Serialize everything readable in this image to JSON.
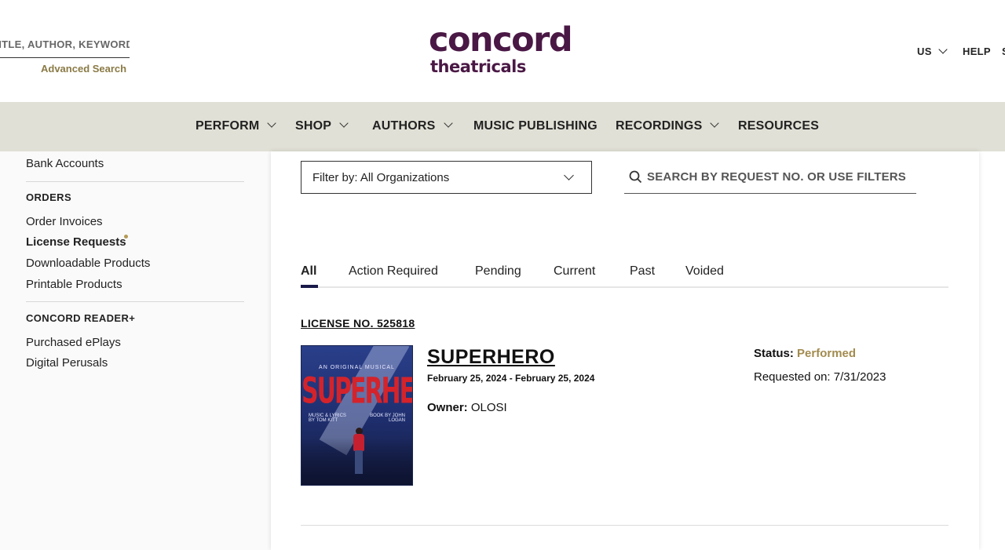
{
  "header": {
    "search_placeholder": "TITLE, AUTHOR, KEYWORD",
    "advanced_search": "Advanced Search",
    "logo_top": "concord",
    "logo_bottom": "theatricals",
    "region": "US",
    "help": "HELP"
  },
  "nav": {
    "items": [
      {
        "label": "PERFORM",
        "dropdown": true
      },
      {
        "label": "SHOP",
        "dropdown": true
      },
      {
        "label": "AUTHORS",
        "dropdown": true
      },
      {
        "label": "MUSIC PUBLISHING",
        "dropdown": false
      },
      {
        "label": "RECORDINGS",
        "dropdown": true
      },
      {
        "label": "RESOURCES",
        "dropdown": false
      }
    ]
  },
  "sidebar": {
    "bank_accounts": "Bank Accounts",
    "orders_heading": "ORDERS",
    "order_invoices": "Order Invoices",
    "license_requests": "License Requests",
    "downloadable_products": "Downloadable Products",
    "printable_products": "Printable Products",
    "reader_heading": "CONCORD READER+",
    "purchased_eplays": "Purchased ePlays",
    "digital_perusals": "Digital Perusals"
  },
  "filters": {
    "filter_label": "Filter by: All Organizations",
    "search_placeholder": "SEARCH BY REQUEST NO. OR USE FILTERS"
  },
  "tabs": [
    {
      "label": "All",
      "active": true
    },
    {
      "label": "Action Required",
      "active": false
    },
    {
      "label": "Pending",
      "active": false
    },
    {
      "label": "Current",
      "active": false
    },
    {
      "label": "Past",
      "active": false
    },
    {
      "label": "Voided",
      "active": false
    }
  ],
  "license": {
    "number": "LICENSE NO. 525818",
    "poster": {
      "subtitle": "AN ORIGINAL MUSICAL",
      "title": "SUPERHERO",
      "credit_left": "MUSIC & LYRICS BY TOM KITT",
      "credit_right": "BOOK BY JOHN LOGAN"
    },
    "show_title": "SUPERHERO",
    "dates": "February 25, 2024 - February 25, 2024",
    "owner_label": "Owner:",
    "owner_value": "OLOSI",
    "status_label": "Status:",
    "status_value": "Performed",
    "requested": "Requested on: 7/31/2023"
  },
  "colors": {
    "brand": "#4a1845",
    "nav_bg": "#e1e0d6",
    "gold": "#a28b4e",
    "tab_accent": "#1a1a4a"
  }
}
